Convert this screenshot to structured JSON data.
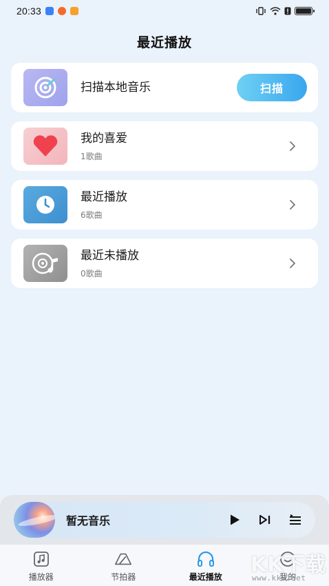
{
  "status_bar": {
    "time": "20:33",
    "notifications": [
      "message-icon",
      "weibo-icon",
      "app-icon"
    ],
    "battery_level": 1.0
  },
  "page": {
    "title": "最近播放"
  },
  "scan_card": {
    "title": "扫描本地音乐",
    "button_label": "扫描",
    "icon": "scan-target-icon"
  },
  "lists": [
    {
      "title": "我的喜爱",
      "subtitle": "1歌曲",
      "icon": "heart-icon"
    },
    {
      "title": "最近播放",
      "subtitle": "6歌曲",
      "icon": "clock-icon"
    },
    {
      "title": "最近未播放",
      "subtitle": "0歌曲",
      "icon": "disc-music-icon"
    }
  ],
  "player": {
    "title": "暂无音乐",
    "controls": [
      "play-icon",
      "next-icon",
      "playlist-icon"
    ]
  },
  "nav": {
    "items": [
      {
        "label": "播放器",
        "icon": "music-square-icon"
      },
      {
        "label": "节拍器",
        "icon": "metronome-icon"
      },
      {
        "label": "最近播放",
        "icon": "headphones-icon",
        "active": true
      },
      {
        "label": "我的",
        "icon": "profile-icon"
      }
    ]
  },
  "watermark": {
    "brand": "KK下载",
    "url": "www.kkx.net"
  },
  "colors": {
    "background": "#eaf2fb",
    "accent": "#39a7ee",
    "heart": "#f0414f",
    "clock_tile": "#4b9fd9"
  }
}
